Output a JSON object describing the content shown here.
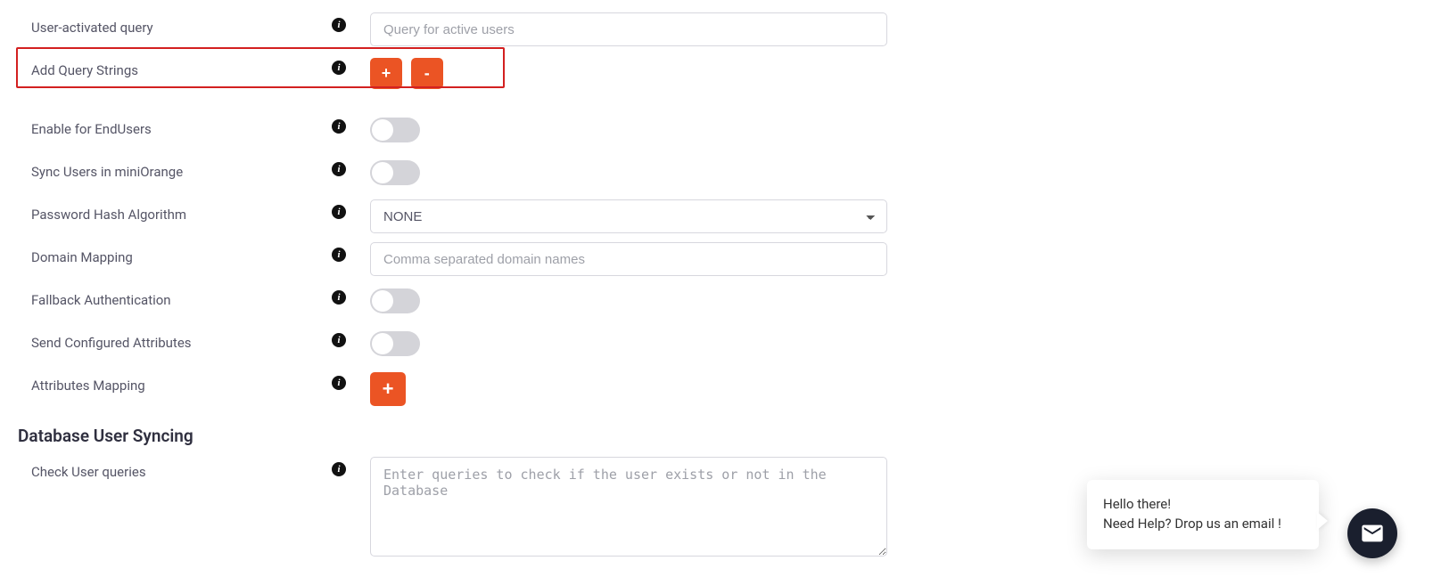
{
  "rows": {
    "user_activated_query": {
      "label": "User-activated query",
      "placeholder": "Query for active users"
    },
    "add_query_strings": {
      "label": "Add Query Strings",
      "plus": "+",
      "minus": "-"
    },
    "enable_end_users": {
      "label": "Enable for EndUsers"
    },
    "sync_users": {
      "label": "Sync Users in miniOrange"
    },
    "password_hash": {
      "label": "Password Hash Algorithm",
      "selected": "NONE"
    },
    "domain_mapping": {
      "label": "Domain Mapping",
      "placeholder": "Comma separated domain names"
    },
    "fallback_auth": {
      "label": "Fallback Authentication"
    },
    "send_configured_attrs": {
      "label": "Send Configured Attributes"
    },
    "attributes_mapping": {
      "label": "Attributes Mapping",
      "plus": "+"
    }
  },
  "section": {
    "db_user_syncing": "Database User Syncing",
    "check_user_queries": {
      "label": "Check User queries",
      "placeholder": "Enter queries to check if the user exists or not in the Database"
    }
  },
  "chat": {
    "line1": "Hello there!",
    "line2": "Need Help? Drop us an email !"
  },
  "info_glyph": "i"
}
